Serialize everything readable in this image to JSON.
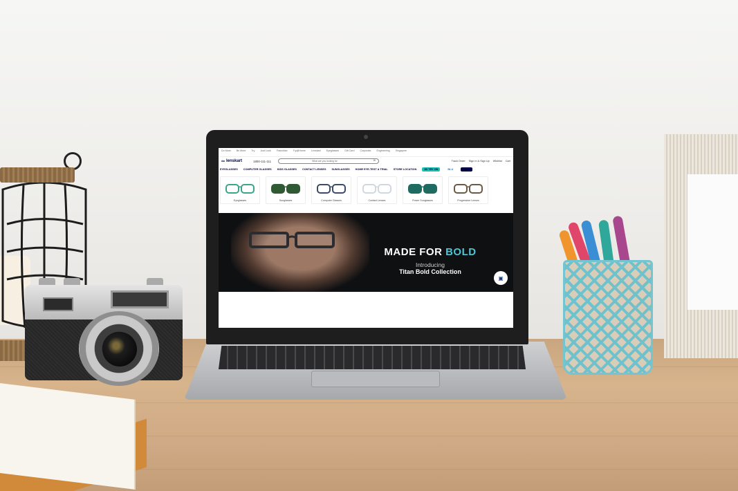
{
  "scene": {
    "description_colors": {
      "wall": "#f1f0ee",
      "desk": "#d2ad85",
      "brand_navy": "#000042",
      "accent_teal": "#4fc4d4"
    }
  },
  "screen": {
    "utility_links": [
      "Do More",
      "Be More",
      "Try",
      "Just Look",
      "Franchise",
      "Try@Home",
      "Lenskart",
      "Eyeglasses",
      "Gift Card",
      "Corporate",
      "Engineering",
      "Singapore"
    ],
    "logo_text": "lenskart",
    "logo_icon": "glasses-icon",
    "phone": "1800-111-111",
    "search_placeholder": "What are you looking for",
    "header_links": [
      "Track Order",
      "Sign In & Sign Up",
      "Wishlist",
      "Cart"
    ],
    "nav_items": [
      "EYEGLASSES",
      "COMPUTER GLASSES",
      "KIDS GLASSES",
      "CONTACT LENSES",
      "SUNGLASSES",
      "HOME EYE-TEST & TRIAL",
      "STORE LOCATION"
    ],
    "badges": [
      {
        "label": "3D TRY ON",
        "color": "#1fbfb0"
      },
      {
        "label": "BLU",
        "color": "#ffffff"
      },
      {
        "label": "GOLD",
        "color": "#000042"
      }
    ],
    "categories": [
      {
        "label": "Eyeglasses",
        "color": "#3aa58a"
      },
      {
        "label": "Sunglasses",
        "color": "#2f5a34"
      },
      {
        "label": "Computer Glasses",
        "color": "#3b4a6b"
      },
      {
        "label": "Contact Lenses",
        "color": "#cfd8e0"
      },
      {
        "label": "Power Sunglasses",
        "color": "#1f6b61"
      },
      {
        "label": "Progressive Lenses",
        "color": "#6b5a43"
      }
    ],
    "banner": {
      "headline_part1": "MADE FOR ",
      "headline_part2": "BOLD",
      "intro": "Introducing",
      "collection": "Titan Bold Collection"
    }
  }
}
